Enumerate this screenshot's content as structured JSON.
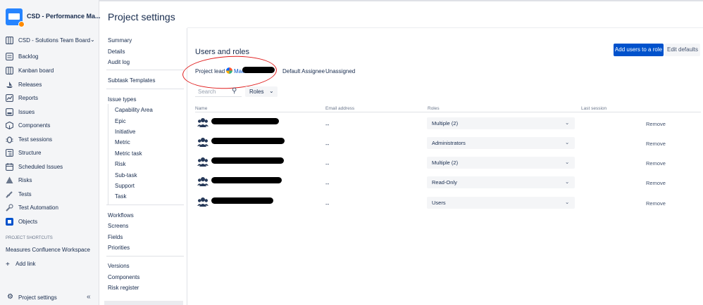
{
  "sidebar": {
    "project_name": "CSD - Performance Ma...",
    "board": "CSD - Solutions Team Board",
    "nav": [
      {
        "label": "Backlog",
        "icon": "backlog-icon"
      },
      {
        "label": "Kanban board",
        "icon": "board-icon"
      },
      {
        "label": "Releases",
        "icon": "ship-icon"
      },
      {
        "label": "Reports",
        "icon": "chart-icon"
      },
      {
        "label": "Issues",
        "icon": "issues-icon"
      },
      {
        "label": "Components",
        "icon": "components-icon"
      },
      {
        "label": "Test sessions",
        "icon": "bug-icon"
      },
      {
        "label": "Structure",
        "icon": "structure-icon"
      },
      {
        "label": "Scheduled Issues",
        "icon": "calendar-icon"
      },
      {
        "label": "Risks",
        "icon": "warning-icon"
      },
      {
        "label": "Tests",
        "icon": "flask-icon"
      },
      {
        "label": "Test Automation",
        "icon": "wrench-icon"
      },
      {
        "label": "Objects",
        "icon": "objects-icon"
      }
    ],
    "shortcuts_title": "PROJECT SHORTCUTS",
    "shortcut": "Measures Confluence Workspace",
    "add_link": "Add link",
    "footer": "Project settings"
  },
  "page_title": "Project settings",
  "settings_menu": {
    "group1": [
      "Summary",
      "Details",
      "Audit log"
    ],
    "subtask_templates": "Subtask Templates",
    "issue_types": "Issue types",
    "issue_type_items": [
      "Capability Area",
      "Epic",
      "Initiative",
      "Metric",
      "Metric task",
      "Risk",
      "Sub-task",
      "Support",
      "Task"
    ],
    "group3": [
      "Workflows",
      "Screens",
      "Fields",
      "Priorities"
    ],
    "group4": [
      "Versions",
      "Components",
      "Risk register"
    ]
  },
  "main": {
    "heading": "Users and roles",
    "add_users_button": "Add users to a role",
    "edit_defaults_button": "Edit defaults",
    "project_lead_label": "Project lead",
    "project_lead_name": "Maes",
    "default_assignee_label": "Default Assignee",
    "default_assignee_value": "Unassigned",
    "search_placeholder": "Search",
    "roles_filter": "Roles",
    "columns": {
      "name": "Name",
      "email": "Email address",
      "roles": "Roles",
      "last_session": "Last session"
    },
    "rows": [
      {
        "email": "--",
        "role": "Multiple (2)",
        "action": "Remove"
      },
      {
        "email": "--",
        "role": "Administrators",
        "action": "Remove"
      },
      {
        "email": "--",
        "role": "Multiple (2)",
        "action": "Remove"
      },
      {
        "email": "--",
        "role": "Read-Only",
        "action": "Remove"
      },
      {
        "email": "--",
        "role": "Users",
        "action": "Remove"
      }
    ]
  },
  "colors": {
    "primary": "#0052cc",
    "annotation": "#e01b1b",
    "sidebar_bg": "#f4f5f7"
  }
}
